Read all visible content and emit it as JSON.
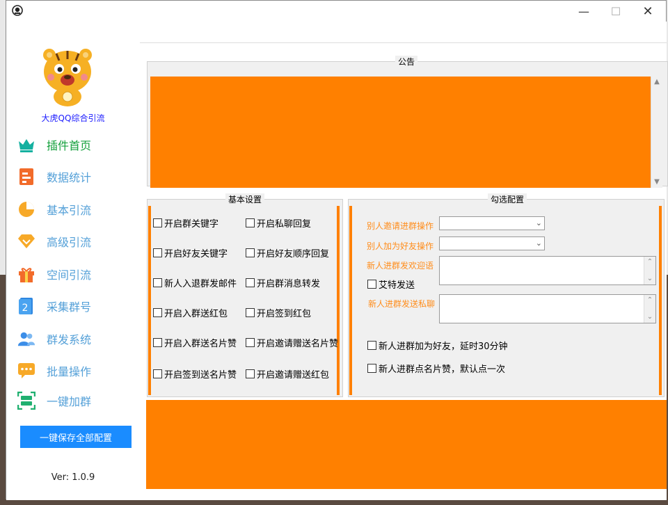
{
  "app": {
    "logo_text": "大虎QQ综合引流",
    "save_button": "一键保存全部配置",
    "version": "Ver: 1.0.9",
    "window_controls": [
      "minimize-icon",
      "maximize-icon",
      "close-icon"
    ]
  },
  "sidebar": {
    "items": [
      {
        "label": "插件首页",
        "icon": "crown-icon",
        "active": true
      },
      {
        "label": "数据统计",
        "icon": "report-icon",
        "active": false
      },
      {
        "label": "基本引流",
        "icon": "pie-chart-icon",
        "active": false
      },
      {
        "label": "高级引流",
        "icon": "diamond-icon",
        "active": false
      },
      {
        "label": "空间引流",
        "icon": "gift-icon",
        "active": false
      },
      {
        "label": "采集群号",
        "icon": "number-two-icon",
        "active": false
      },
      {
        "label": "群发系统",
        "icon": "users-icon",
        "active": false
      },
      {
        "label": "批量操作",
        "icon": "chat-bubble-icon",
        "active": false
      },
      {
        "label": "一键加群",
        "icon": "scan-icon",
        "active": false
      }
    ]
  },
  "notice": {
    "title": "公告"
  },
  "basic": {
    "title": "基本设置",
    "options": [
      [
        "开启群关键字",
        "开启私聊回复"
      ],
      [
        "开启好友关键字",
        "开启好友顺序回复"
      ],
      [
        "新人入退群发邮件",
        "开启群消息转发"
      ],
      [
        "开启入群送红包",
        "开启签到红包"
      ],
      [
        "开启入群送名片赞",
        "开启邀请赠送名片赞"
      ],
      [
        "开启签到送名片赞",
        "开启邀请赠送红包"
      ]
    ]
  },
  "check": {
    "title": "勾选配置",
    "invite_label": "别人邀请进群操作",
    "friend_label": "别人加为好友操作",
    "welcome_label": "新人进群发欢迎语",
    "at_send": "艾特发送",
    "private_label": "新人进群发送私聊",
    "add_friend": "新人进群加为好友，延时30分钟",
    "like_card": "新人进群点名片赞，默认点一次"
  },
  "colors": {
    "accent_orange": "#ff8000",
    "nav_blue": "#54a0d8",
    "nav_active": "#14a03c",
    "button_blue": "#1a8cff"
  }
}
